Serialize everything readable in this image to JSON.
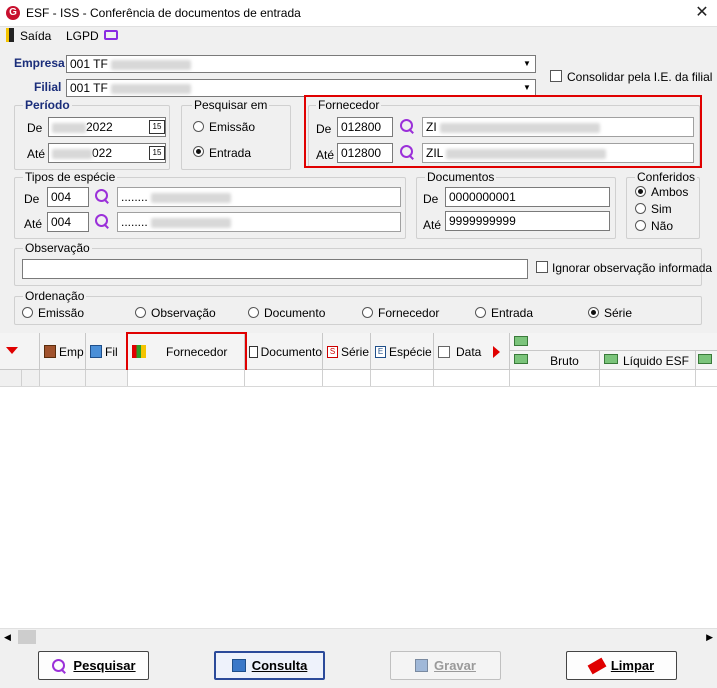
{
  "window": {
    "title": "ESF - ISS - Conferência de documentos de entrada",
    "close": "✕"
  },
  "menu": {
    "exit_label": "Saída",
    "lgpd_label": "LGPD"
  },
  "empresa": {
    "label": "Empresa",
    "value": "001 TF"
  },
  "filial": {
    "label": "Filial",
    "value": "001 TF"
  },
  "consolidar": {
    "label": "Consolidar pela I.E. da filial",
    "checked": false
  },
  "periodo": {
    "title": "Período",
    "de_label": "De",
    "de_value": "2022",
    "ate_label": "Até",
    "ate_value": "022",
    "cal_icon": "15"
  },
  "pesquisar_em": {
    "title": "Pesquisar em",
    "options": [
      "Emissão",
      "Entrada"
    ],
    "selected": "Entrada"
  },
  "fornecedor": {
    "title": "Fornecedor",
    "de_label": "De",
    "de_code": "012800",
    "de_name": "ZI",
    "ate_label": "Até",
    "ate_code": "012800",
    "ate_name": "ZIL"
  },
  "tipos_especie": {
    "title": "Tipos de espécie",
    "de_label": "De",
    "de_code": "004",
    "de_name": "........",
    "ate_label": "Até",
    "ate_code": "004",
    "ate_name": "........"
  },
  "documentos": {
    "title": "Documentos",
    "de_label": "De",
    "de_value": "0000000001",
    "ate_label": "Até",
    "ate_value": "9999999999"
  },
  "conferidos": {
    "title": "Conferidos",
    "options": [
      "Ambos",
      "Sim",
      "Não"
    ],
    "selected": "Ambos"
  },
  "observacao": {
    "title": "Observação",
    "value": "",
    "ignorar_label": "Ignorar observação informada"
  },
  "ordenacao": {
    "title": "Ordenação",
    "options": [
      "Emissão",
      "Observação",
      "Documento",
      "Fornecedor",
      "Entrada",
      "Série"
    ],
    "selected": "Série"
  },
  "grid": {
    "columns": [
      "Emp",
      "Fil",
      "Fornecedor",
      "Documento",
      "Série",
      "Espécie",
      "Data"
    ],
    "right_columns": [
      "Bruto",
      "Líquido ESF"
    ]
  },
  "buttons": {
    "pesquisar": "Pesquisar",
    "consulta": "Consulta",
    "gravar": "Gravar",
    "limpar": "Limpar"
  },
  "colors": {
    "accent": "#1a2d7a",
    "highlight": "#e00000",
    "search_icon": "#9b30d9"
  }
}
